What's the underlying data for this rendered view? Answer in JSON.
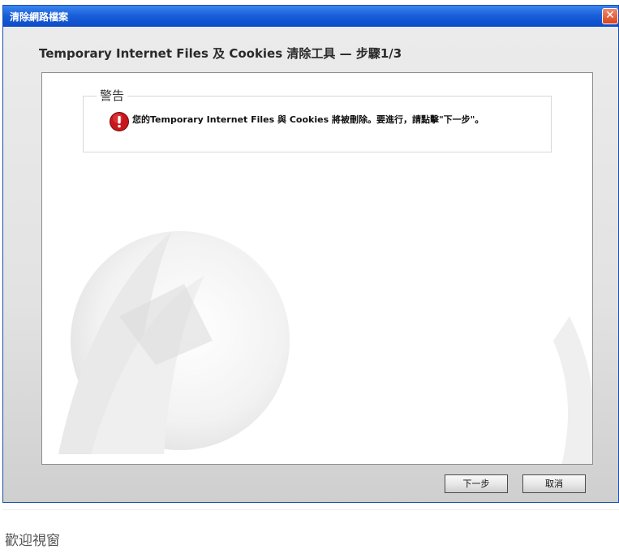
{
  "window": {
    "title": "清除網路檔案",
    "close_glyph": "✕"
  },
  "wizard": {
    "step_title": "Temporary Internet Files 及 Cookies 清除工具 — 步驟1/3"
  },
  "warning": {
    "legend": "警告",
    "icon": "exclamation-icon",
    "message": "您的Temporary Internet Files 與 Cookies 將被刪除。要進行，請點擊\"下一步\"。"
  },
  "buttons": {
    "next_label": "下一步",
    "cancel_label": "取消"
  },
  "caption": "歡迎視窗",
  "colors": {
    "titlebar": "#0c4bc8",
    "warning_icon": "#c8161d",
    "close_button": "#d9441f"
  }
}
